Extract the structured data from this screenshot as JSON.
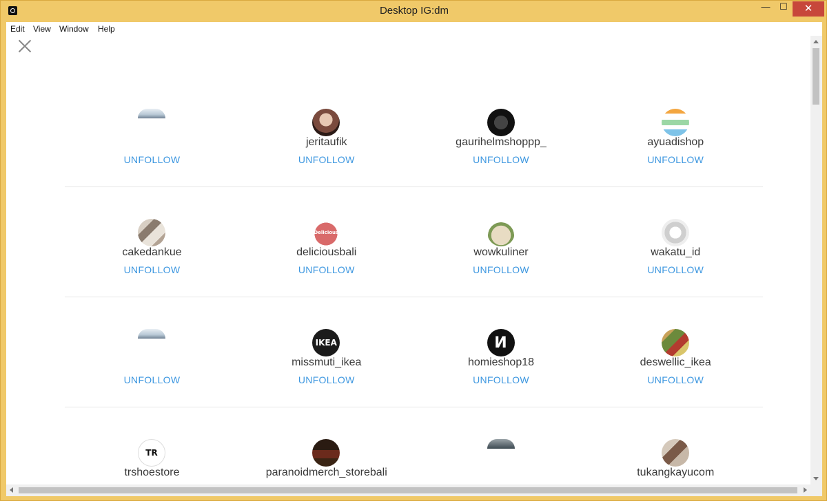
{
  "window": {
    "title": "Desktop IG:dm",
    "minimize_glyph": "—",
    "maximize_glyph": "☐",
    "close_glyph": "✕"
  },
  "menu": {
    "items": [
      "Edit",
      "View",
      "Window",
      "Help"
    ]
  },
  "action_label": "UNFOLLOW",
  "accounts": [
    [
      {
        "username": "",
        "avatar": "sky"
      },
      {
        "username": "jeritaufik",
        "avatar": "person"
      },
      {
        "username": "gaurihelmshoppp_",
        "avatar": "dark-logo"
      },
      {
        "username": "ayuadishop",
        "avatar": "flyer"
      }
    ],
    [
      {
        "username": "cakedankue",
        "avatar": "cakes"
      },
      {
        "username": "deliciousbali",
        "avatar": "heart"
      },
      {
        "username": "wowkuliner",
        "avatar": "food"
      },
      {
        "username": "wakatu_id",
        "avatar": "watch"
      }
    ],
    [
      {
        "username": "",
        "avatar": "sky"
      },
      {
        "username": "missmuti_ikea",
        "avatar": "ikea"
      },
      {
        "username": "homieshop18",
        "avatar": "letter-n"
      },
      {
        "username": "deswellic_ikea",
        "avatar": "shelves"
      }
    ],
    [
      {
        "username": "trshoestore",
        "avatar": "tr-logo"
      },
      {
        "username": "paranoidmerch_storebali",
        "avatar": "store"
      },
      {
        "username": "",
        "avatar": "stone"
      },
      {
        "username": "tukangkayucom",
        "avatar": "room"
      }
    ]
  ],
  "avatar_text": {
    "ikea": "IKEA",
    "letter-n": "И",
    "tr-logo": "TR",
    "heart": "Delicious"
  }
}
